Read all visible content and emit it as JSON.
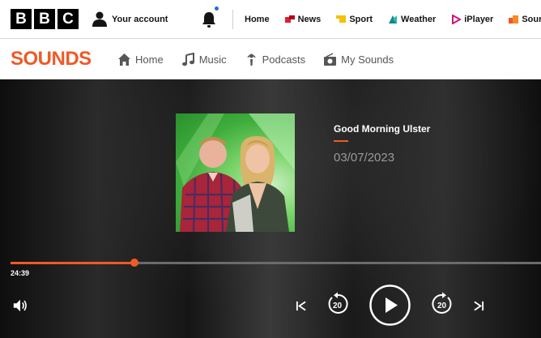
{
  "global_bar": {
    "logo_letters": [
      "B",
      "B",
      "C"
    ],
    "account_label": "Your account",
    "nav": [
      {
        "id": "home",
        "label": "Home",
        "icon": "none",
        "color": ""
      },
      {
        "id": "news",
        "label": "News",
        "icon": "news-icon",
        "color": "#e0202a"
      },
      {
        "id": "sport",
        "label": "Sport",
        "icon": "sport-icon",
        "color": "#f5c200"
      },
      {
        "id": "weather",
        "label": "Weather",
        "icon": "weather-icon",
        "color": "#0b8a8a"
      },
      {
        "id": "iplayer",
        "label": "iPlayer",
        "icon": "iplayer-icon",
        "color": "#d1157a"
      },
      {
        "id": "sounds",
        "label": "Sounds",
        "icon": "sounds-icon",
        "color": "#ef5a26"
      }
    ],
    "notification_dot_color": "#1f6ee0"
  },
  "sounds_nav": {
    "logo": "SOUNDS",
    "logo_color": "#ef5a26",
    "items": [
      {
        "id": "home",
        "label": "Home",
        "icon": "house-icon"
      },
      {
        "id": "music",
        "label": "Music",
        "icon": "music-note-icon"
      },
      {
        "id": "podcasts",
        "label": "Podcasts",
        "icon": "podcast-icon"
      },
      {
        "id": "my-sounds",
        "label": "My Sounds",
        "icon": "radio-icon"
      }
    ]
  },
  "player": {
    "title": "Good Morning Ulster",
    "date": "03/07/2023",
    "elapsed": "24:39",
    "progress_fraction": 0.234,
    "accent_color": "#ef5a26",
    "skip_back_seconds": "20",
    "skip_forward_seconds": "20",
    "controls": [
      "volume-icon",
      "previous-icon",
      "rewind-20-icon",
      "play-icon",
      "forward-20-icon",
      "next-icon"
    ]
  }
}
